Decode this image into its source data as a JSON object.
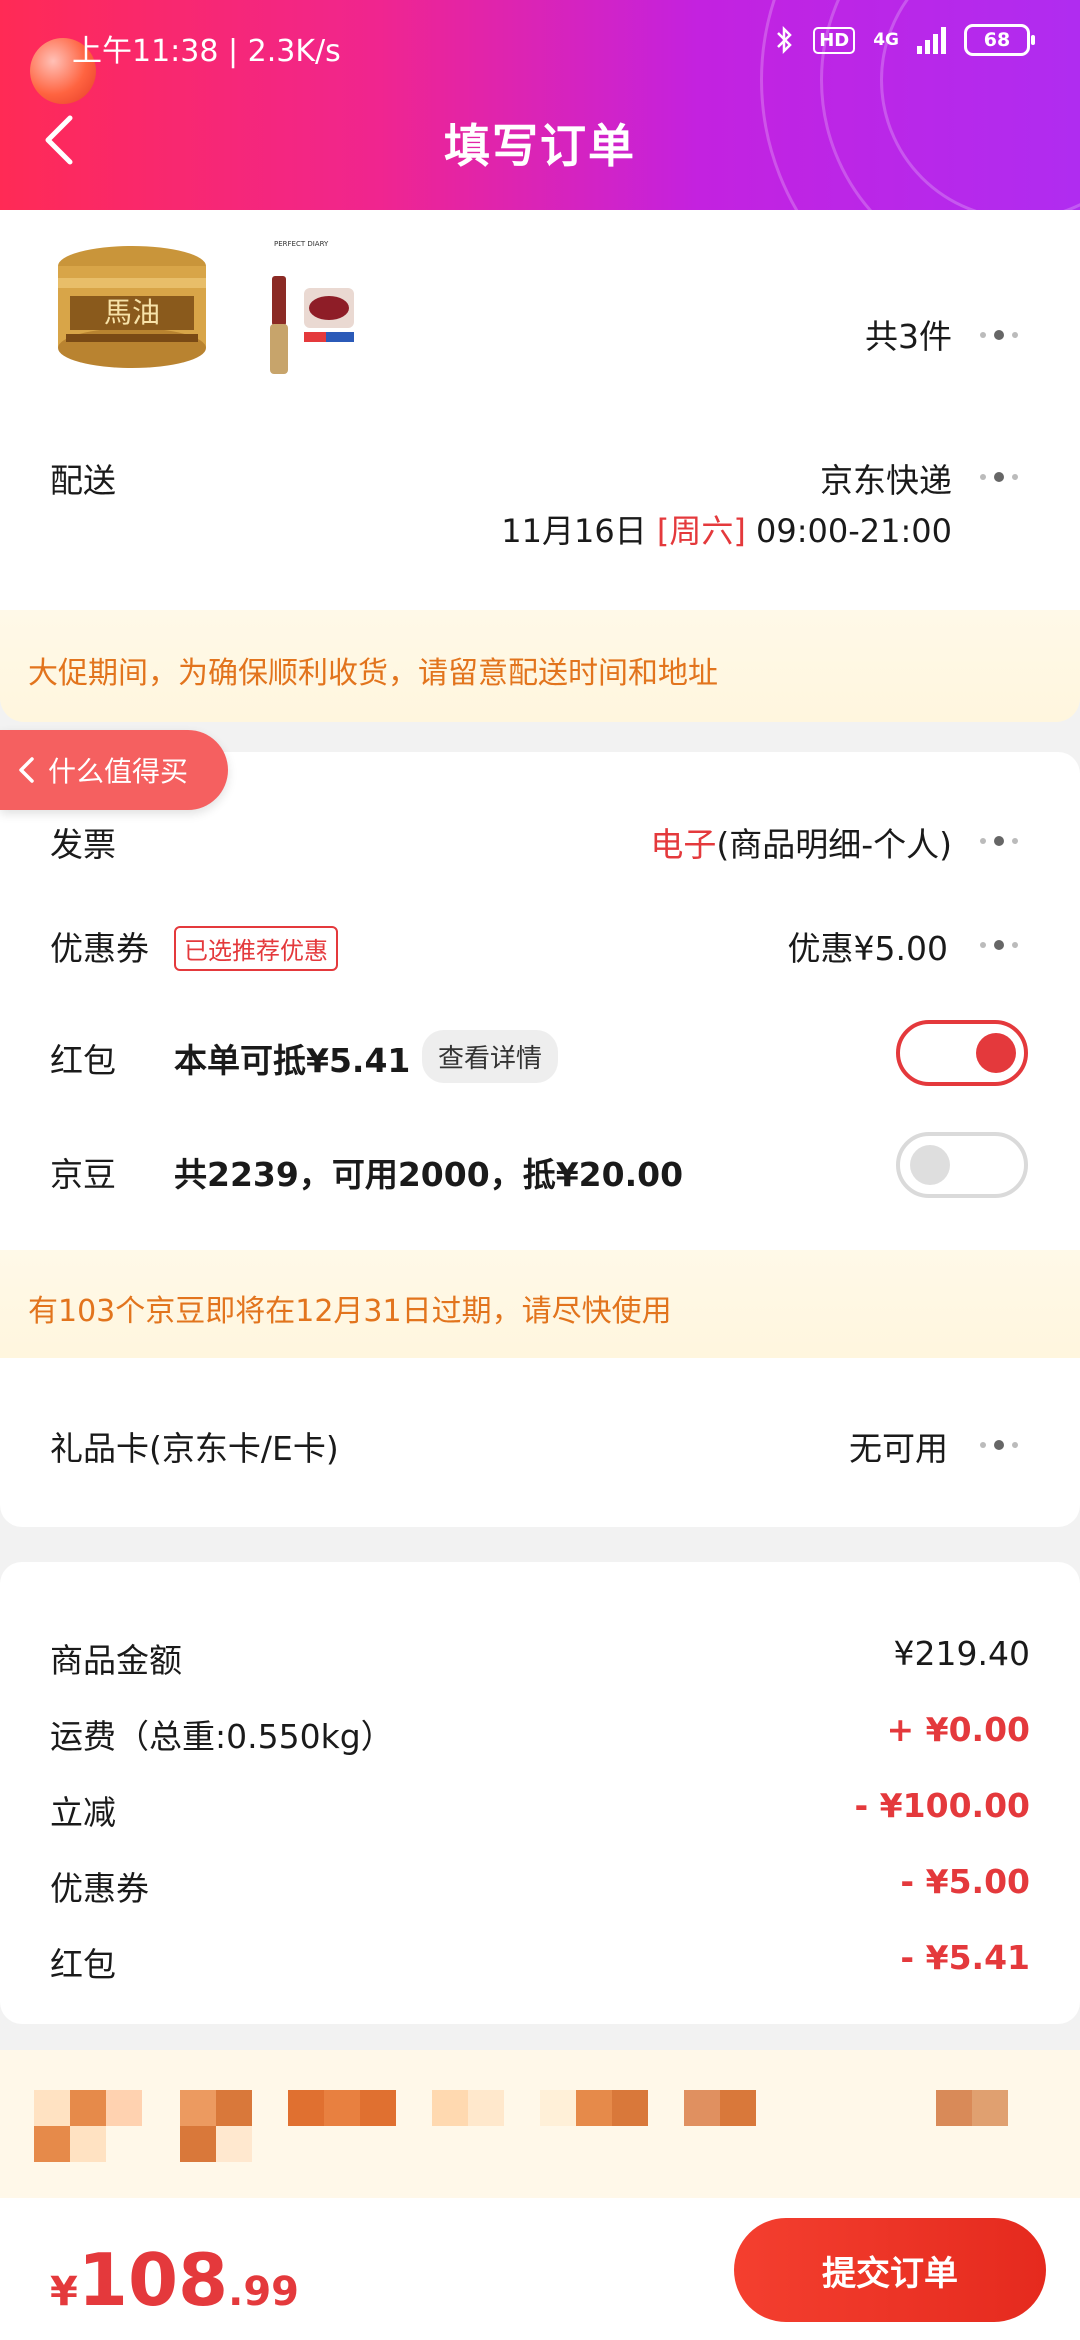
{
  "status_bar": {
    "time": "上午11:38 | 2.3K/s",
    "hd": "HD",
    "network": "4G",
    "battery": "68"
  },
  "header": {
    "title": "填写订单"
  },
  "goods": {
    "count_label": "共3件",
    "brand_small": "PERFECT DIARY"
  },
  "delivery": {
    "label": "配送",
    "carrier": "京东快递",
    "date": "11月16日",
    "weekday": "[周六]",
    "time_range": "09:00-21:00"
  },
  "notice1": "大促期间，为确保顺利收货，请留意配送时间和地址",
  "float_tab": "什么值得买",
  "invoice": {
    "label": "发票",
    "type": "电子",
    "detail": "(商品明细-个人)"
  },
  "coupon": {
    "label": "优惠券",
    "tag": "已选推荐优惠",
    "value": "优惠¥5.00"
  },
  "redpacket": {
    "label": "红包",
    "text": "本单可抵¥5.41",
    "details_button": "查看详情",
    "enabled": true
  },
  "jingdou": {
    "label": "京豆",
    "text": "共2239，可用2000，抵¥20.00",
    "enabled": false
  },
  "notice2": "有103个京豆即将在12月31日过期，请尽快使用",
  "giftcard": {
    "label": "礼品卡(京东卡/E卡)",
    "value": "无可用"
  },
  "summary": [
    {
      "label": "商品金额",
      "value": "¥219.40",
      "color": "#1a1a1a"
    },
    {
      "label": "运费（总重:0.550kg）",
      "value": "+ ¥0.00",
      "color": "#e4393c"
    },
    {
      "label": "立减",
      "value": "- ¥100.00",
      "color": "#e4393c"
    },
    {
      "label": "优惠券",
      "value": "- ¥5.00",
      "color": "#e4393c"
    },
    {
      "label": "红包",
      "value": "- ¥5.41",
      "color": "#e4393c"
    }
  ],
  "footer": {
    "currency": "¥",
    "amount_int": "108",
    "amount_dec": ".99",
    "submit_label": "提交订单"
  },
  "colors": {
    "accent": "#e4393c",
    "notice": "#e2741d"
  }
}
